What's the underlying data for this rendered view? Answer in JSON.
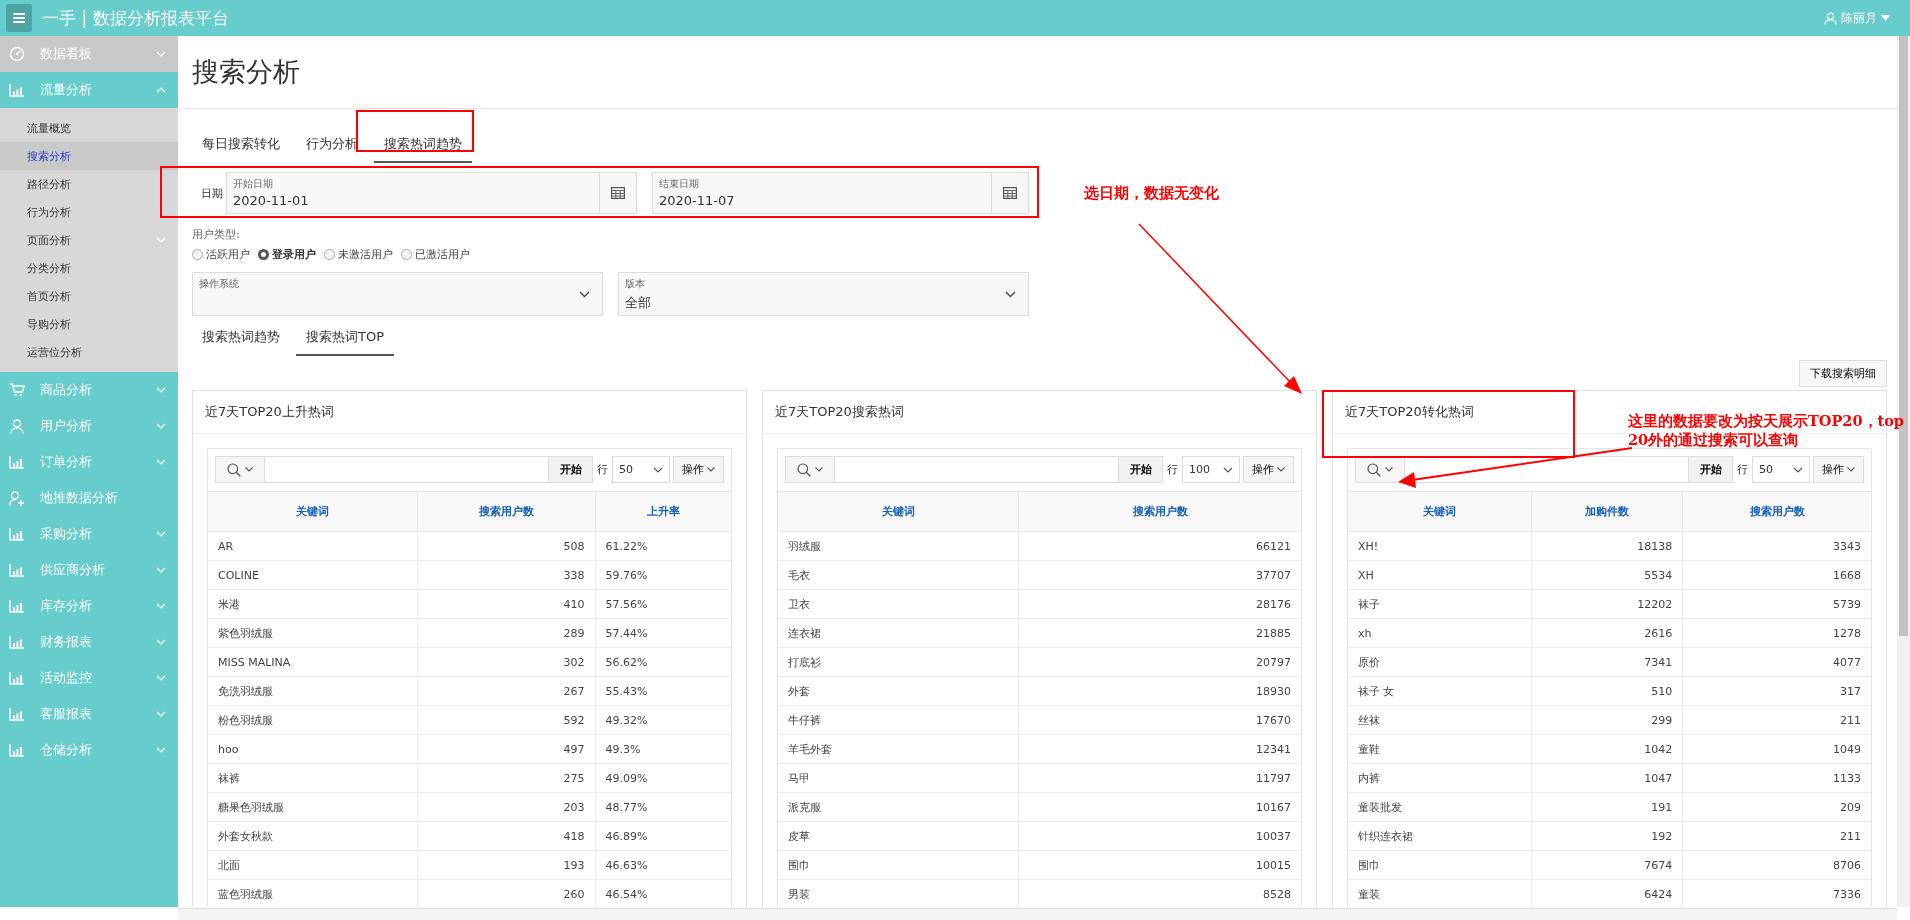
{
  "header": {
    "title": "一手 | 数据分析报表平台",
    "user": "陈丽月"
  },
  "sidebar": {
    "items": [
      {
        "label": "数据看板",
        "kind": "dashboard",
        "selected": true,
        "expanded": false,
        "has_children": true
      },
      {
        "label": "流量分析",
        "kind": "chart",
        "selected": false,
        "expanded": true,
        "has_children": true,
        "children": [
          {
            "label": "流量概览",
            "selected": false,
            "has_children": false
          },
          {
            "label": "搜索分析",
            "selected": true,
            "has_children": false
          },
          {
            "label": "路径分析",
            "selected": false,
            "has_children": false
          },
          {
            "label": "行为分析",
            "selected": false,
            "has_children": false
          },
          {
            "label": "页面分析",
            "selected": false,
            "has_children": true
          },
          {
            "label": "分类分析",
            "selected": false,
            "has_children": false
          },
          {
            "label": "首页分析",
            "selected": false,
            "has_children": false
          },
          {
            "label": "导购分析",
            "selected": false,
            "has_children": false
          },
          {
            "label": "运营位分析",
            "selected": false,
            "has_children": false
          }
        ]
      },
      {
        "label": "商品分析",
        "kind": "cart",
        "selected": false,
        "expanded": false,
        "has_children": true
      },
      {
        "label": "用户分析",
        "kind": "user",
        "selected": false,
        "expanded": false,
        "has_children": true
      },
      {
        "label": "订单分析",
        "kind": "chart",
        "selected": false,
        "expanded": false,
        "has_children": true
      },
      {
        "label": "地推数据分析",
        "kind": "user-add",
        "selected": false,
        "expanded": false,
        "has_children": false
      },
      {
        "label": "采购分析",
        "kind": "chart",
        "selected": false,
        "expanded": false,
        "has_children": true
      },
      {
        "label": "供应商分析",
        "kind": "chart",
        "selected": false,
        "expanded": false,
        "has_children": true
      },
      {
        "label": "库存分析",
        "kind": "chart",
        "selected": false,
        "expanded": false,
        "has_children": true
      },
      {
        "label": "财务报表",
        "kind": "chart",
        "selected": false,
        "expanded": false,
        "has_children": true
      },
      {
        "label": "活动监控",
        "kind": "chart",
        "selected": false,
        "expanded": false,
        "has_children": true
      },
      {
        "label": "客服报表",
        "kind": "chart",
        "selected": false,
        "expanded": false,
        "has_children": true
      },
      {
        "label": "仓储分析",
        "kind": "chart",
        "selected": false,
        "expanded": false,
        "has_children": true
      }
    ]
  },
  "page_title": "搜索分析",
  "tabs": [
    {
      "label": "每日搜索转化",
      "selected": false
    },
    {
      "label": "行为分析",
      "selected": false
    },
    {
      "label": "搜索热词趋势",
      "selected": true
    }
  ],
  "date_filter": {
    "label": "日期",
    "start": {
      "label": "开始日期",
      "value": "2020-11-01"
    },
    "end": {
      "label": "结束日期",
      "value": "2020-11-07"
    }
  },
  "user_type": {
    "label": "用户类型:",
    "options": [
      {
        "label": "活跃用户",
        "selected": false
      },
      {
        "label": "登录用户",
        "selected": true
      },
      {
        "label": "未激活用户",
        "selected": false
      },
      {
        "label": "已激活用户",
        "selected": false
      }
    ]
  },
  "selects": [
    {
      "label": "操作系统"
    },
    {
      "label": "版本",
      "value": "全部"
    }
  ],
  "subtabs": [
    {
      "label": "搜索热词趋势",
      "selected": false
    },
    {
      "label": "搜索热词TOP",
      "selected": true
    }
  ],
  "download_button": "下载搜索明细",
  "panels": [
    {
      "title": "近7天TOP20上升热词",
      "go": "开始",
      "rows_label": "行",
      "rows_per_page": "50",
      "actions": "操作",
      "columns": [
        {
          "label": "关键词",
          "kind": "text"
        },
        {
          "label": "搜索用户数",
          "kind": "number"
        },
        {
          "label": "上升率",
          "kind": "percent"
        }
      ],
      "rows": [
        [
          "AR",
          "508",
          "61.22%"
        ],
        [
          "COLINE",
          "338",
          "59.76%"
        ],
        [
          "米港",
          "410",
          "57.56%"
        ],
        [
          "紫色羽绒服",
          "289",
          "57.44%"
        ],
        [
          "MISS MALINA",
          "302",
          "56.62%"
        ],
        [
          "免洗羽绒服",
          "267",
          "55.43%"
        ],
        [
          "粉色羽绒服",
          "592",
          "49.32%"
        ],
        [
          "hoo",
          "497",
          "49.3%"
        ],
        [
          "袜裤",
          "275",
          "49.09%"
        ],
        [
          "糖果色羽绒服",
          "203",
          "48.77%"
        ],
        [
          "外套女秋款",
          "418",
          "46.89%"
        ],
        [
          "北面",
          "193",
          "46.63%"
        ],
        [
          "蓝色羽绒服",
          "260",
          "46.54%"
        ]
      ]
    },
    {
      "title": "近7天TOP20搜索热词",
      "go": "开始",
      "rows_label": "行",
      "rows_per_page": "100",
      "actions": "操作",
      "columns": [
        {
          "label": "关键词",
          "kind": "text"
        },
        {
          "label": "搜索用户数",
          "kind": "number"
        }
      ],
      "rows": [
        [
          "羽绒服",
          "66121"
        ],
        [
          "毛衣",
          "37707"
        ],
        [
          "卫衣",
          "28176"
        ],
        [
          "连衣裙",
          "21885"
        ],
        [
          "打底衫",
          "20797"
        ],
        [
          "外套",
          "18930"
        ],
        [
          "牛仔裤",
          "17670"
        ],
        [
          "羊毛外套",
          "12341"
        ],
        [
          "马甲",
          "11797"
        ],
        [
          "派克服",
          "10167"
        ],
        [
          "皮草",
          "10037"
        ],
        [
          "围巾",
          "10015"
        ],
        [
          "男装",
          "8528"
        ]
      ]
    },
    {
      "title": "近7天TOP20转化热词",
      "go": "开始",
      "rows_label": "行",
      "rows_per_page": "50",
      "actions": "操作",
      "columns": [
        {
          "label": "关键词",
          "kind": "text"
        },
        {
          "label": "加购件数",
          "kind": "number"
        },
        {
          "label": "搜索用户数",
          "kind": "number"
        }
      ],
      "rows": [
        [
          "XH!",
          "18138",
          "3343"
        ],
        [
          "XH",
          "5534",
          "1668"
        ],
        [
          "袜子",
          "12202",
          "5739"
        ],
        [
          "xh",
          "2616",
          "1278"
        ],
        [
          "原价",
          "7341",
          "4077"
        ],
        [
          "袜子 女",
          "510",
          "317"
        ],
        [
          "丝袜",
          "299",
          "211"
        ],
        [
          "童鞋",
          "1042",
          "1049"
        ],
        [
          "内裤",
          "1047",
          "1133"
        ],
        [
          "童装批发",
          "191",
          "209"
        ],
        [
          "针织连衣裙",
          "192",
          "211"
        ],
        [
          "围巾",
          "7674",
          "8706"
        ],
        [
          "童装",
          "6424",
          "7336"
        ]
      ]
    }
  ],
  "annotations": {
    "notes": [
      "选日期，数据无变化",
      "这里的数据要改为按天展示TOP20，top20外的通过搜索可以查询"
    ]
  }
}
